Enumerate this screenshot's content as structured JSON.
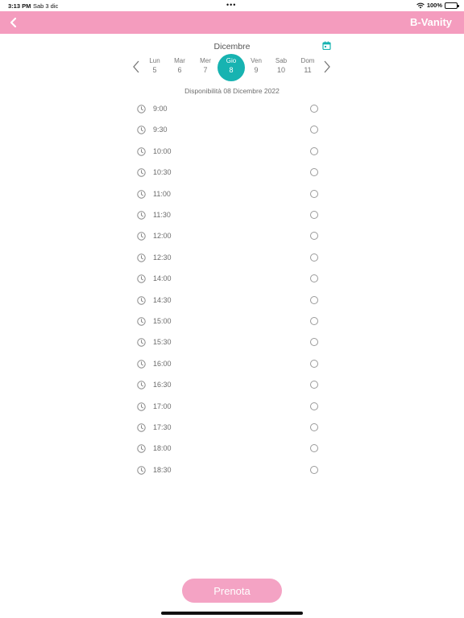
{
  "status_bar": {
    "time": "3:13 PM",
    "date": "Sab 3 dic",
    "dots": "•••",
    "battery": "100%"
  },
  "nav": {
    "title": "B-Vanity"
  },
  "calendar": {
    "month": "Dicembre",
    "days": [
      {
        "name": "Lun",
        "number": "5"
      },
      {
        "name": "Mar",
        "number": "6"
      },
      {
        "name": "Mer",
        "number": "7"
      },
      {
        "name": "Gio",
        "number": "8"
      },
      {
        "name": "Ven",
        "number": "9"
      },
      {
        "name": "Sab",
        "number": "10"
      },
      {
        "name": "Dom",
        "number": "11"
      }
    ],
    "selected_index": 3,
    "selected_color": "#17b3b1"
  },
  "availability": {
    "label": "Disponibilità 08 Dicembre 2022",
    "slots": [
      "9:00",
      "9:30",
      "10:00",
      "10:30",
      "11:00",
      "11:30",
      "12:00",
      "12:30",
      "14:00",
      "14:30",
      "15:00",
      "15:30",
      "16:00",
      "16:30",
      "17:00",
      "17:30",
      "18:00",
      "18:30"
    ]
  },
  "actions": {
    "book_label": "Prenota"
  },
  "colors": {
    "brand_pink": "#f49cbe",
    "button_pink": "#f4a3c4",
    "accent_teal": "#17b3b1"
  }
}
